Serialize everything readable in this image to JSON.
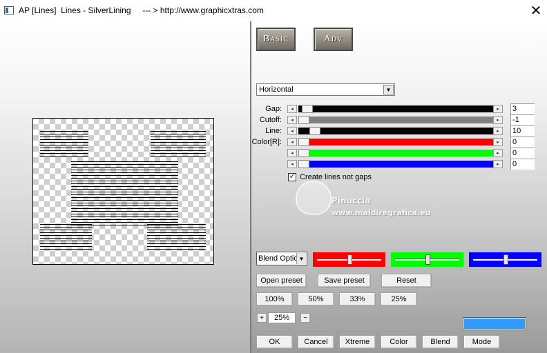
{
  "window": {
    "title": "AP [Lines]  Lines - SilverLining     --- > http://www.graphicxtras.com",
    "close_symbol": "✕"
  },
  "tabs": {
    "basic": "Basic",
    "adv": "Adv"
  },
  "mode_select": {
    "value": "Horizontal"
  },
  "sliders": [
    {
      "label": "Gap:",
      "value": "3",
      "track_color": "#000000",
      "position": 0.02
    },
    {
      "label": "Cutoff:",
      "value": "-1",
      "track_color": "#808080",
      "position": 0.0
    },
    {
      "label": "Line:",
      "value": "10",
      "track_color": "#000000",
      "position": 0.06
    },
    {
      "label": "Color[R]:",
      "value": "0",
      "track_color": "#ff0000",
      "position": 0.0
    },
    {
      "label": "",
      "value": "0",
      "track_color": "#00ff00",
      "position": 0.0
    },
    {
      "label": "",
      "value": "0",
      "track_color": "#0000ff",
      "position": 0.0
    }
  ],
  "checkbox": {
    "label": "Create lines not gaps",
    "checked": true,
    "mark": "✓"
  },
  "watermark": {
    "line1": "Pinuccia",
    "line2": "www.maidiregrafica.eu"
  },
  "blend": {
    "option": "Blend Options",
    "colors": [
      {
        "color": "#ff0000",
        "level": 0.5
      },
      {
        "color": "#00ff00",
        "level": 0.5
      },
      {
        "color": "#0000ff",
        "level": 0.5
      }
    ]
  },
  "buttons": {
    "open_preset": "Open preset",
    "save_preset": "Save preset",
    "reset": "Reset",
    "zoom_100": "100%",
    "zoom_50": "50%",
    "zoom_33": "33%",
    "zoom_25": "25%",
    "ok": "OK",
    "cancel": "Cancel",
    "xtreme": "Xtreme",
    "color": "Color",
    "blend": "Blend",
    "mode": "Mode"
  },
  "zoom": {
    "plus": "+",
    "minus": "−",
    "value": "25%"
  },
  "swatch_color": "#3399ff"
}
